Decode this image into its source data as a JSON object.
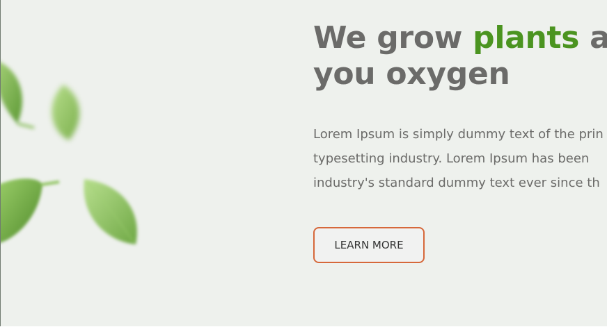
{
  "hero": {
    "headline": {
      "line1_prefix": "We grow ",
      "line1_accent": "plants",
      "line1_suffix": " and",
      "line2": "you oxygen"
    },
    "body_lines": [
      "Lorem Ipsum is simply dummy text of the prin",
      "typesetting industry. Lorem Ipsum has been",
      "industry's standard dummy text ever since th"
    ],
    "cta_label": "LEARN MORE"
  },
  "colors": {
    "background": "#eef1ed",
    "text": "#6b6b69",
    "accent": "#4b9420",
    "button_border": "#d6683a"
  },
  "icons": [
    "leaf-icon"
  ]
}
